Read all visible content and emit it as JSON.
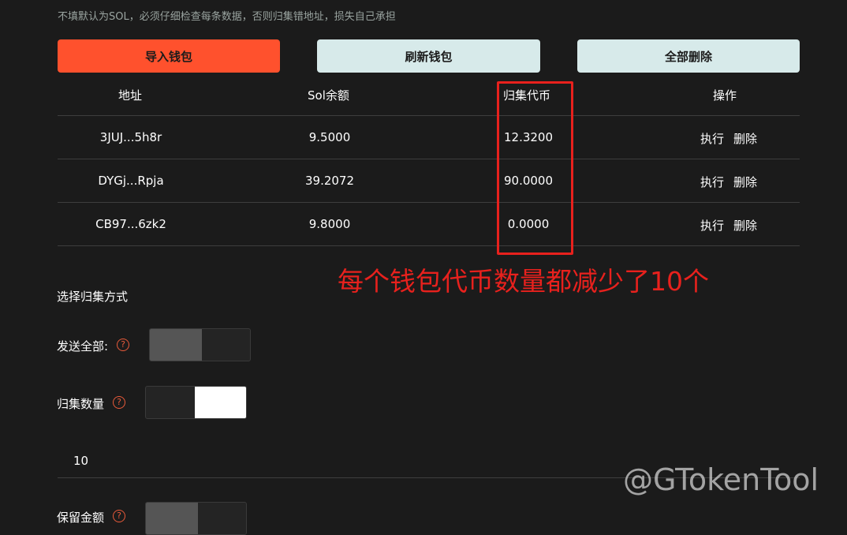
{
  "hint": "不填默认为SOL，必须仔细检查每条数据，否则归集错地址，损失自己承担",
  "buttons": {
    "import": "导入钱包",
    "refresh": "刷新钱包",
    "delete_all": "全部删除"
  },
  "table": {
    "headers": [
      "地址",
      "Sol余额",
      "归集代币",
      "操作"
    ],
    "rows": [
      {
        "address": "3JUJ...5h8r",
        "sol": "9.5000",
        "token": "12.3200"
      },
      {
        "address": "DYGj...Rpja",
        "sol": "39.2072",
        "token": "90.0000"
      },
      {
        "address": "CB97...6zk2",
        "sol": "9.8000",
        "token": "0.0000"
      }
    ],
    "action_execute": "执行",
    "action_delete": "删除"
  },
  "annotation": "每个钱包代币数量都减少了10个",
  "section_title": "选择归集方式",
  "send_all_label": "发送全部:",
  "collect_amount_label": "归集数量",
  "amount_value": "10",
  "truncated_label": "保留金额",
  "help_icon_glyph": "?",
  "watermark": "@GTokenTool",
  "colors": {
    "background": "#1b1b1b",
    "primary": "#ff512d",
    "secondary": "#d7eaea",
    "annotation_red": "#e8211d"
  }
}
